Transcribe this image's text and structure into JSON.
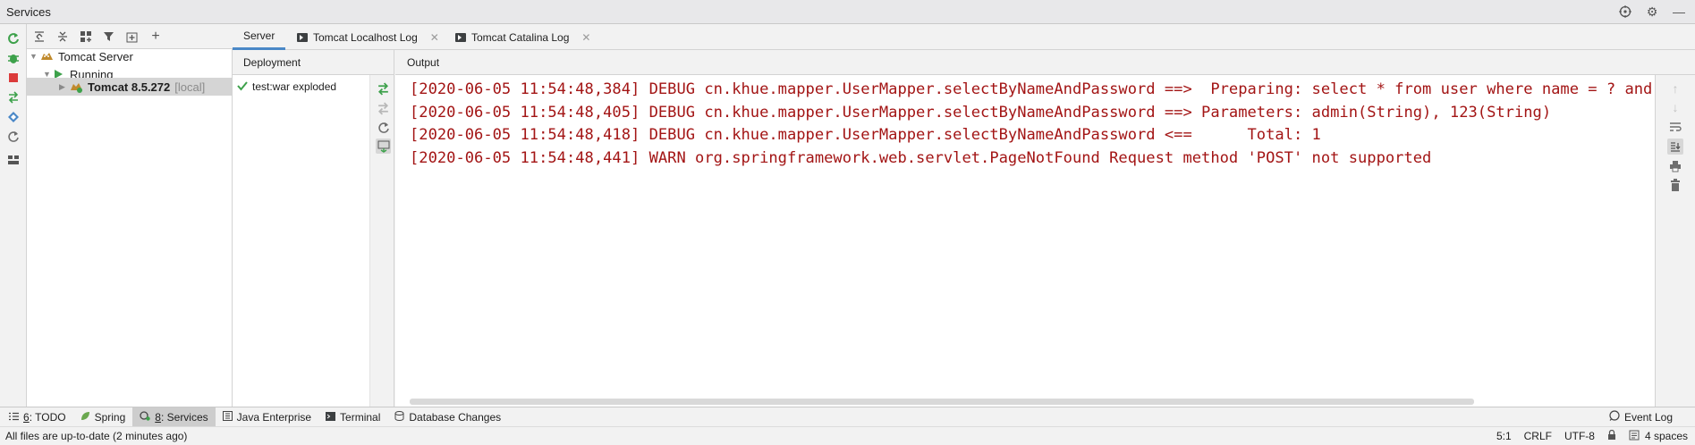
{
  "window": {
    "title": "Services"
  },
  "tree": {
    "root": "Tomcat Server",
    "group": "Running",
    "selected_label": "Tomcat 8.5.272",
    "selected_suffix": "[local]"
  },
  "tabs": [
    {
      "label": "Server"
    },
    {
      "label": "Tomcat Localhost Log"
    },
    {
      "label": "Tomcat Catalina Log"
    }
  ],
  "deployment": {
    "header": "Deployment",
    "items": [
      {
        "label": "test:war exploded"
      }
    ]
  },
  "output": {
    "header": "Output",
    "lines": [
      "[2020-06-05 11:54:48,384] DEBUG cn.khue.mapper.UserMapper.selectByNameAndPassword ==>  Preparing: select * from user where name = ? and password = ?",
      "[2020-06-05 11:54:48,405] DEBUG cn.khue.mapper.UserMapper.selectByNameAndPassword ==> Parameters: admin(String), 123(String)",
      "[2020-06-05 11:54:48,418] DEBUG cn.khue.mapper.UserMapper.selectByNameAndPassword <==      Total: 1",
      "[2020-06-05 11:54:48,441] WARN org.springframework.web.servlet.PageNotFound Request method 'POST' not supported"
    ]
  },
  "toolwindows": [
    {
      "num": "6",
      "label": ": TODO",
      "icon": "list-icon"
    },
    {
      "num": "",
      "label": "Spring",
      "icon": "spring-leaf-icon"
    },
    {
      "num": "8",
      "label": ": Services",
      "icon": "services-icon"
    },
    {
      "num": "",
      "label": "Java Enterprise",
      "icon": "java-enterprise-icon"
    },
    {
      "num": "",
      "label": "Terminal",
      "icon": "terminal-icon"
    },
    {
      "num": "",
      "label": "Database Changes",
      "icon": "database-changes-icon"
    }
  ],
  "event_log": "Event Log",
  "status": {
    "message": "All files are up-to-date (2 minutes ago)",
    "position": "5:1",
    "line_separator": "CRLF",
    "encoding": "UTF-8",
    "indent": "4 spaces"
  },
  "colors": {
    "log_text": "#a31515",
    "run_green": "#3da14b",
    "stop_red": "#db3b3b",
    "tab_underline": "#4a88c7"
  }
}
